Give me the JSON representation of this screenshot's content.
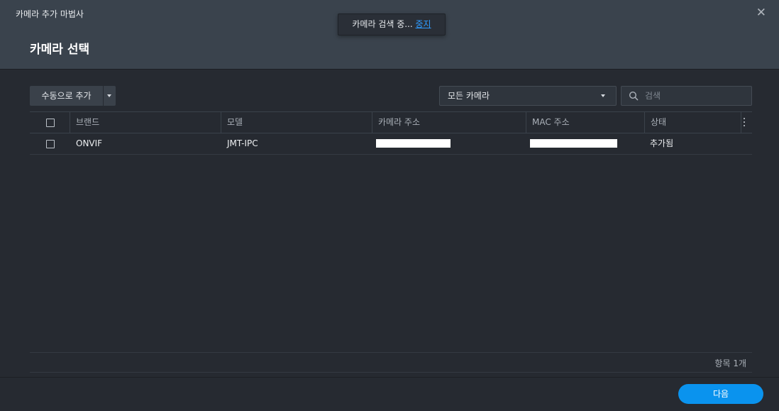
{
  "window": {
    "title": "카메라 추가 마법사",
    "close_symbol": "✕"
  },
  "page_title": "카메라 선택",
  "toast": {
    "text": "카메라 검색 중... ",
    "link": "중지"
  },
  "toolbar": {
    "add_manual_label": "수동으로 추가",
    "filter_value": "모든 카메라",
    "search_placeholder": "검색"
  },
  "table": {
    "columns": [
      "브랜드",
      "모델",
      "카메라 주소",
      "MAC 주소",
      "상태"
    ],
    "rows": [
      {
        "brand": "ONVIF",
        "model": "JMT-IPC",
        "address": "",
        "mac": "",
        "status": "추가됨",
        "address_redacted": true,
        "mac_redacted": true
      }
    ]
  },
  "footer": {
    "count": "항목 1개",
    "next_label": "다음"
  },
  "colors": {
    "accent": "#0a93ee",
    "link": "#2e9bff",
    "header_bg": "#3a434d",
    "body_bg": "#262a31"
  }
}
